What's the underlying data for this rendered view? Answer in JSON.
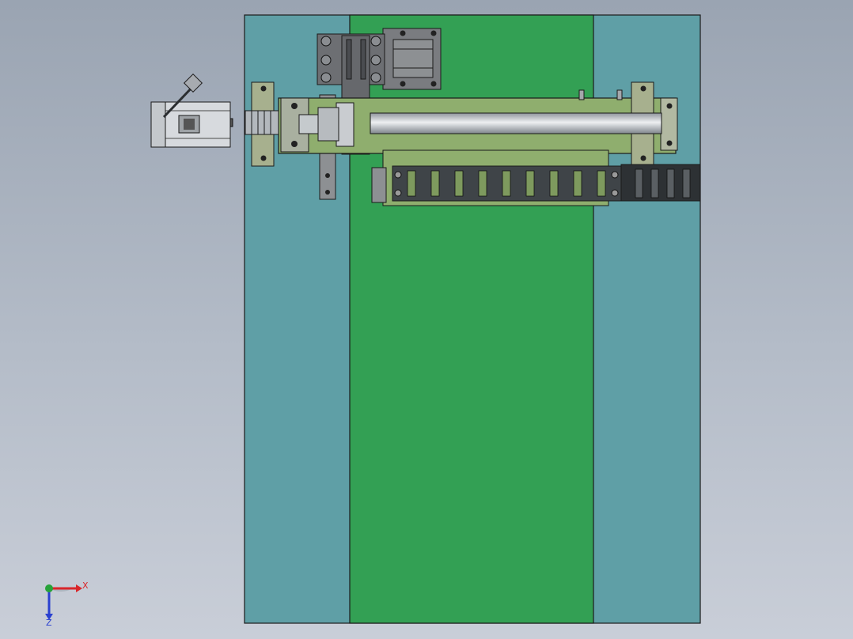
{
  "viewport": {
    "view": "top",
    "background": [
      "#9aa4b2",
      "#c9ced8"
    ]
  },
  "colors": {
    "base_plate": "#5f9fa6",
    "center_plate": "#33a054",
    "rail_base": "#8fae6e",
    "screw_shaft": "#b8bec6",
    "motor_body": "#d7dade",
    "bracket": "#6d6f73",
    "cable_chain": "#3f4448",
    "axis_x": "#d9262a",
    "axis_y": "#27a33a",
    "axis_z": "#2a40d0",
    "outline": "#1a1a1a"
  },
  "triad": {
    "x_label": "X",
    "z_label": "Z",
    "icon": "coordinate-triad-icon"
  },
  "components": {
    "servo_motor": "servo-motor-icon",
    "coupling": "shaft-coupling-icon",
    "ball_screw": "ball-screw-icon",
    "slider_bracket": "slider-bracket-icon",
    "cable_chain": "drag-chain-icon"
  }
}
